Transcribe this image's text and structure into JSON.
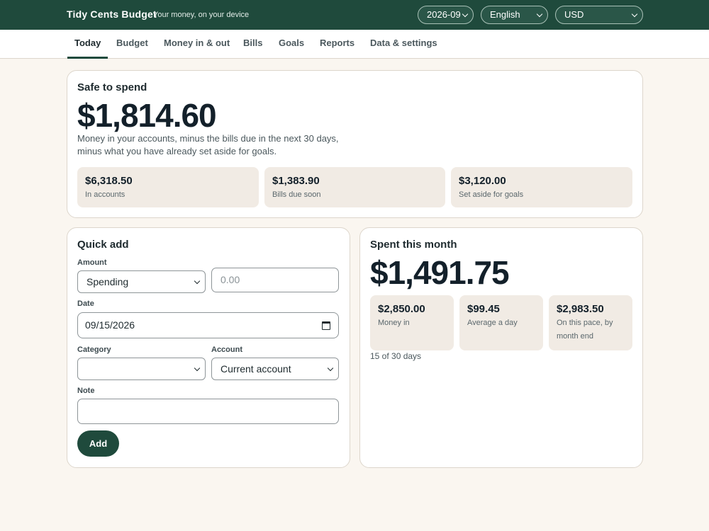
{
  "header": {
    "brand": "Tidy Cents Budget",
    "tagline": "Your money, on your device",
    "month_select": "2026-09",
    "language_select": "English",
    "currency_select": "USD"
  },
  "tabs": [
    {
      "label": "Today",
      "active": true
    },
    {
      "label": "Budget"
    },
    {
      "label": "Money in & out"
    },
    {
      "label": "Bills"
    },
    {
      "label": "Goals"
    },
    {
      "label": "Reports"
    },
    {
      "label": "Data & settings"
    }
  ],
  "safe_to_spend": {
    "title": "Safe to spend",
    "amount": "$1,814.60",
    "description_line1": "Money in your accounts, minus the bills due in the next 30 days,",
    "description_line2": "minus what you have already set aside for goals.",
    "stats": [
      {
        "value": "$6,318.50",
        "label": "In accounts"
      },
      {
        "value": "$1,383.90",
        "label": "Bills due soon"
      },
      {
        "value": "$3,120.00",
        "label": "Set aside for goals"
      }
    ]
  },
  "quick_add": {
    "title": "Quick add",
    "amount_label": "Amount",
    "type_value": "Spending",
    "amount_placeholder": "0.00",
    "date_label": "Date",
    "date_value": "09/15/2026",
    "category_label": "Category",
    "category_value": "",
    "account_label": "Account",
    "account_value": "Current account",
    "note_label": "Note",
    "note_value": "",
    "add_label": "Add"
  },
  "spent_this_month": {
    "title": "Spent this month",
    "amount": "$1,491.75",
    "stats": [
      {
        "value": "$2,850.00",
        "label": "Money in"
      },
      {
        "value": "$99.45",
        "label": "Average a day"
      },
      {
        "value": "$2,983.50",
        "label_line1": "On this pace, by",
        "label_line2": "month end"
      }
    ],
    "progress_text": "15 of 30 days"
  },
  "colors": {
    "header_bg": "#1f4a3c",
    "page_bg": "#faf6f0",
    "stat_bg": "#f1ebe4",
    "accent": "#1f4a3c"
  }
}
